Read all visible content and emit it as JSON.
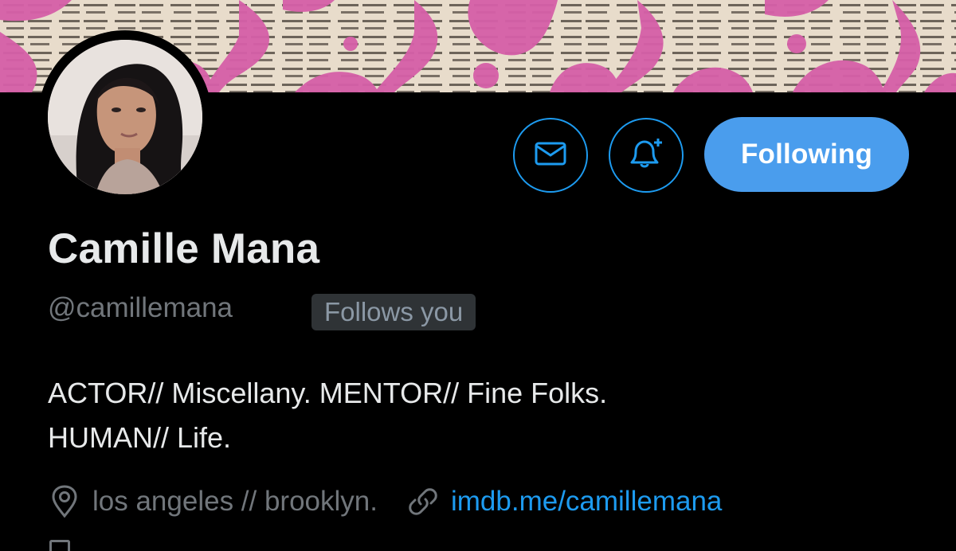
{
  "profile": {
    "display_name": "Camille Mana",
    "handle": "@camillemana",
    "follows_you": "Follows you",
    "bio_line1": "ACTOR// Miscellany. MENTOR// Fine Folks.",
    "bio_line2": "HUMAN// Life.",
    "location": "los angeles // brooklyn.",
    "website": "imdb.me/camillemana"
  },
  "actions": {
    "message_icon": "envelope-icon",
    "notify_icon": "bell-plus-icon",
    "following_label": "Following"
  },
  "colors": {
    "background": "#000000",
    "accent": "#1d9bf0",
    "following_button": "#4a9ded",
    "banner_pink": "#d65fa8",
    "muted_text": "#71767b"
  }
}
